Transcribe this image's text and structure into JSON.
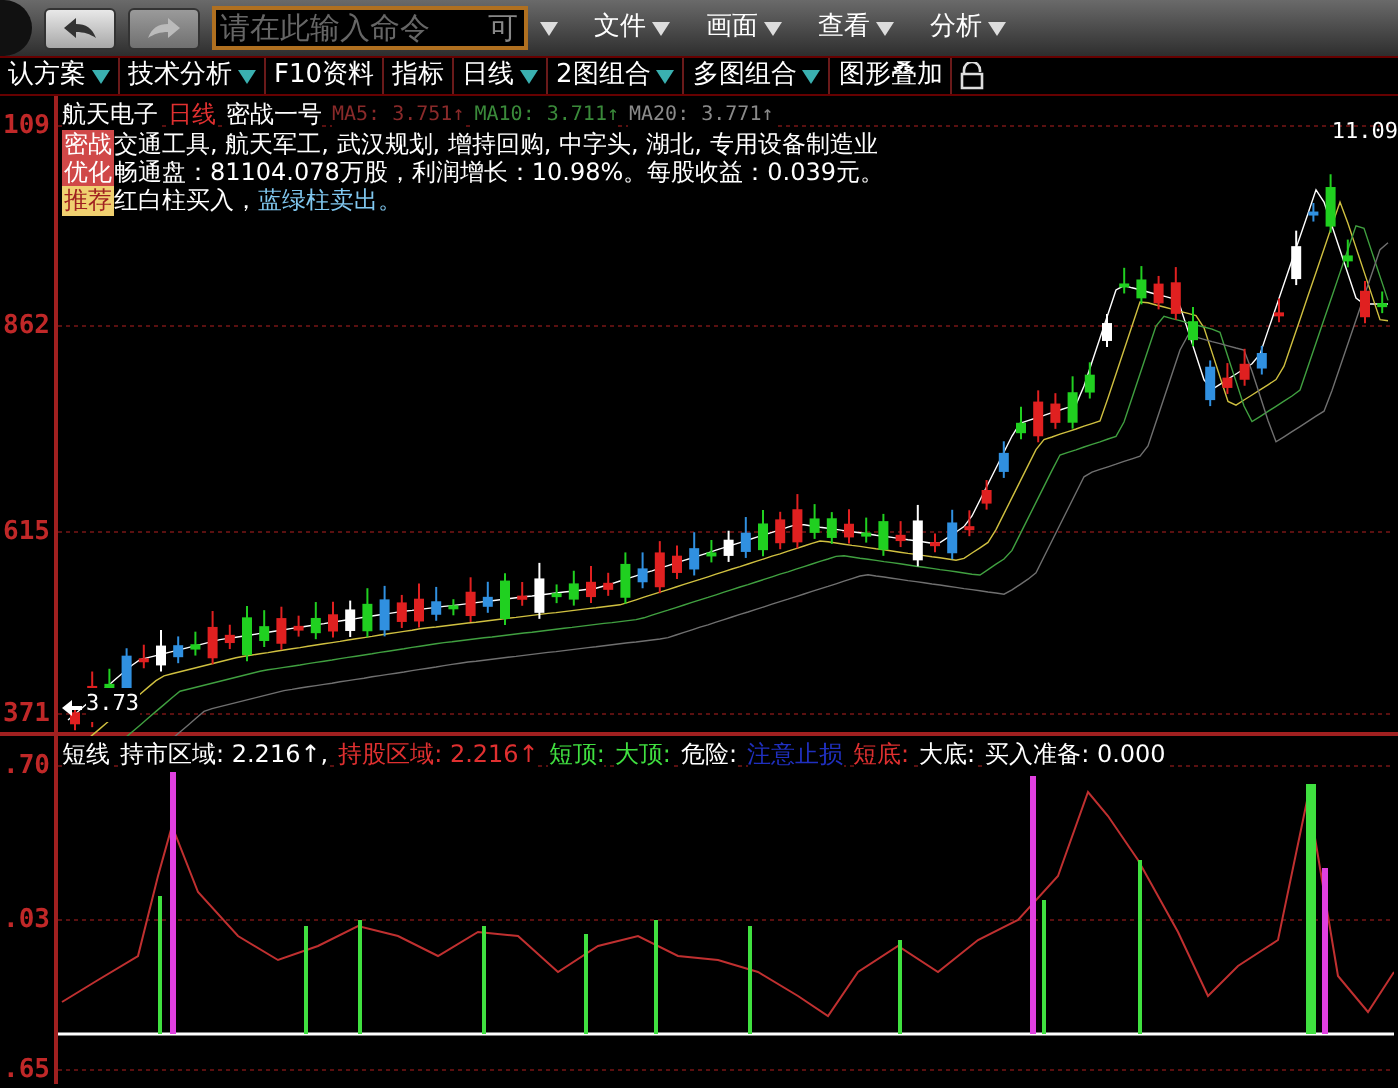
{
  "nav_buttons": [
    {
      "kind": "back",
      "disabled": false
    },
    {
      "kind": "forward",
      "disabled": true
    }
  ],
  "command": {
    "placeholder": "请在此输入命令",
    "hint": "可"
  },
  "menus": [
    {
      "label": "文件"
    },
    {
      "label": "画面"
    },
    {
      "label": "查看"
    },
    {
      "label": "分析"
    }
  ],
  "tabs": [
    {
      "label": "认方案",
      "dropdown": true
    },
    {
      "label": "技术分析",
      "dropdown": true
    },
    {
      "label": "F10资料",
      "dropdown": false
    },
    {
      "label": "指标",
      "dropdown": false
    },
    {
      "label": "日线",
      "dropdown": true
    },
    {
      "label": "2图组合",
      "dropdown": true
    },
    {
      "label": "多图组合",
      "dropdown": true
    },
    {
      "label": "图形叠加",
      "dropdown": false
    }
  ],
  "price_chart": {
    "title": [
      {
        "text": "航天电子",
        "color": "#ffffff"
      },
      {
        "text": "日线",
        "color": "#e03030"
      },
      {
        "text": "密战一号",
        "color": "#ffffff"
      },
      {
        "text": "MA5: 3.751↑",
        "color": "#8a2a2a"
      },
      {
        "text": "MA10: 3.711↑",
        "color": "#3a8a3a"
      },
      {
        "text": "MA20: 3.771↑",
        "color": "#8a8a8a"
      }
    ],
    "info_rows": [
      {
        "badge": {
          "text": "密战优化",
          "color": "#d04848"
        },
        "lines": [
          [
            {
              "text": "交通工具, 航天军工, 武汉规划, 增持回购, 中字头, 湖北, 专用设备制造业",
              "color": "#ffffff"
            }
          ],
          [
            {
              "text": "畅通盘：81104.078万股，利润增长：10.98%。每股收益：0.039元。",
              "color": "#ffffff"
            }
          ]
        ]
      },
      {
        "badge": {
          "text": "推荐",
          "color": "#f0d070"
        },
        "lines": [
          [
            {
              "text": "红白柱买入，",
              "color": "#ffffff"
            },
            {
              "text": "蓝绿柱卖出。",
              "color": "#80c8f0"
            }
          ]
        ]
      }
    ],
    "axis_labels": [
      "109",
      "862",
      "615",
      "371"
    ],
    "high_label": "11.09",
    "low_label": "3.73"
  },
  "indicator": {
    "legend": [
      {
        "text": "短线",
        "color": "#ffffff"
      },
      {
        "text": "持市区域: 2.216↑,",
        "color": "#ffffff"
      },
      {
        "text": "持股区域: 2.216↑",
        "color": "#e03030"
      },
      {
        "text": "短顶:",
        "color": "#40e040"
      },
      {
        "text": "大顶:",
        "color": "#40e040"
      },
      {
        "text": "危险:",
        "color": "#ffffff"
      },
      {
        "text": "注意止损",
        "color": "#2030c0"
      },
      {
        "text": "短底:",
        "color": "#e03030"
      },
      {
        "text": "大底:",
        "color": "#ffffff"
      },
      {
        "text": "买入准备: 0.000",
        "color": "#ffffff"
      }
    ],
    "axis_labels": [
      ".70",
      ".03",
      ".65"
    ]
  }
}
